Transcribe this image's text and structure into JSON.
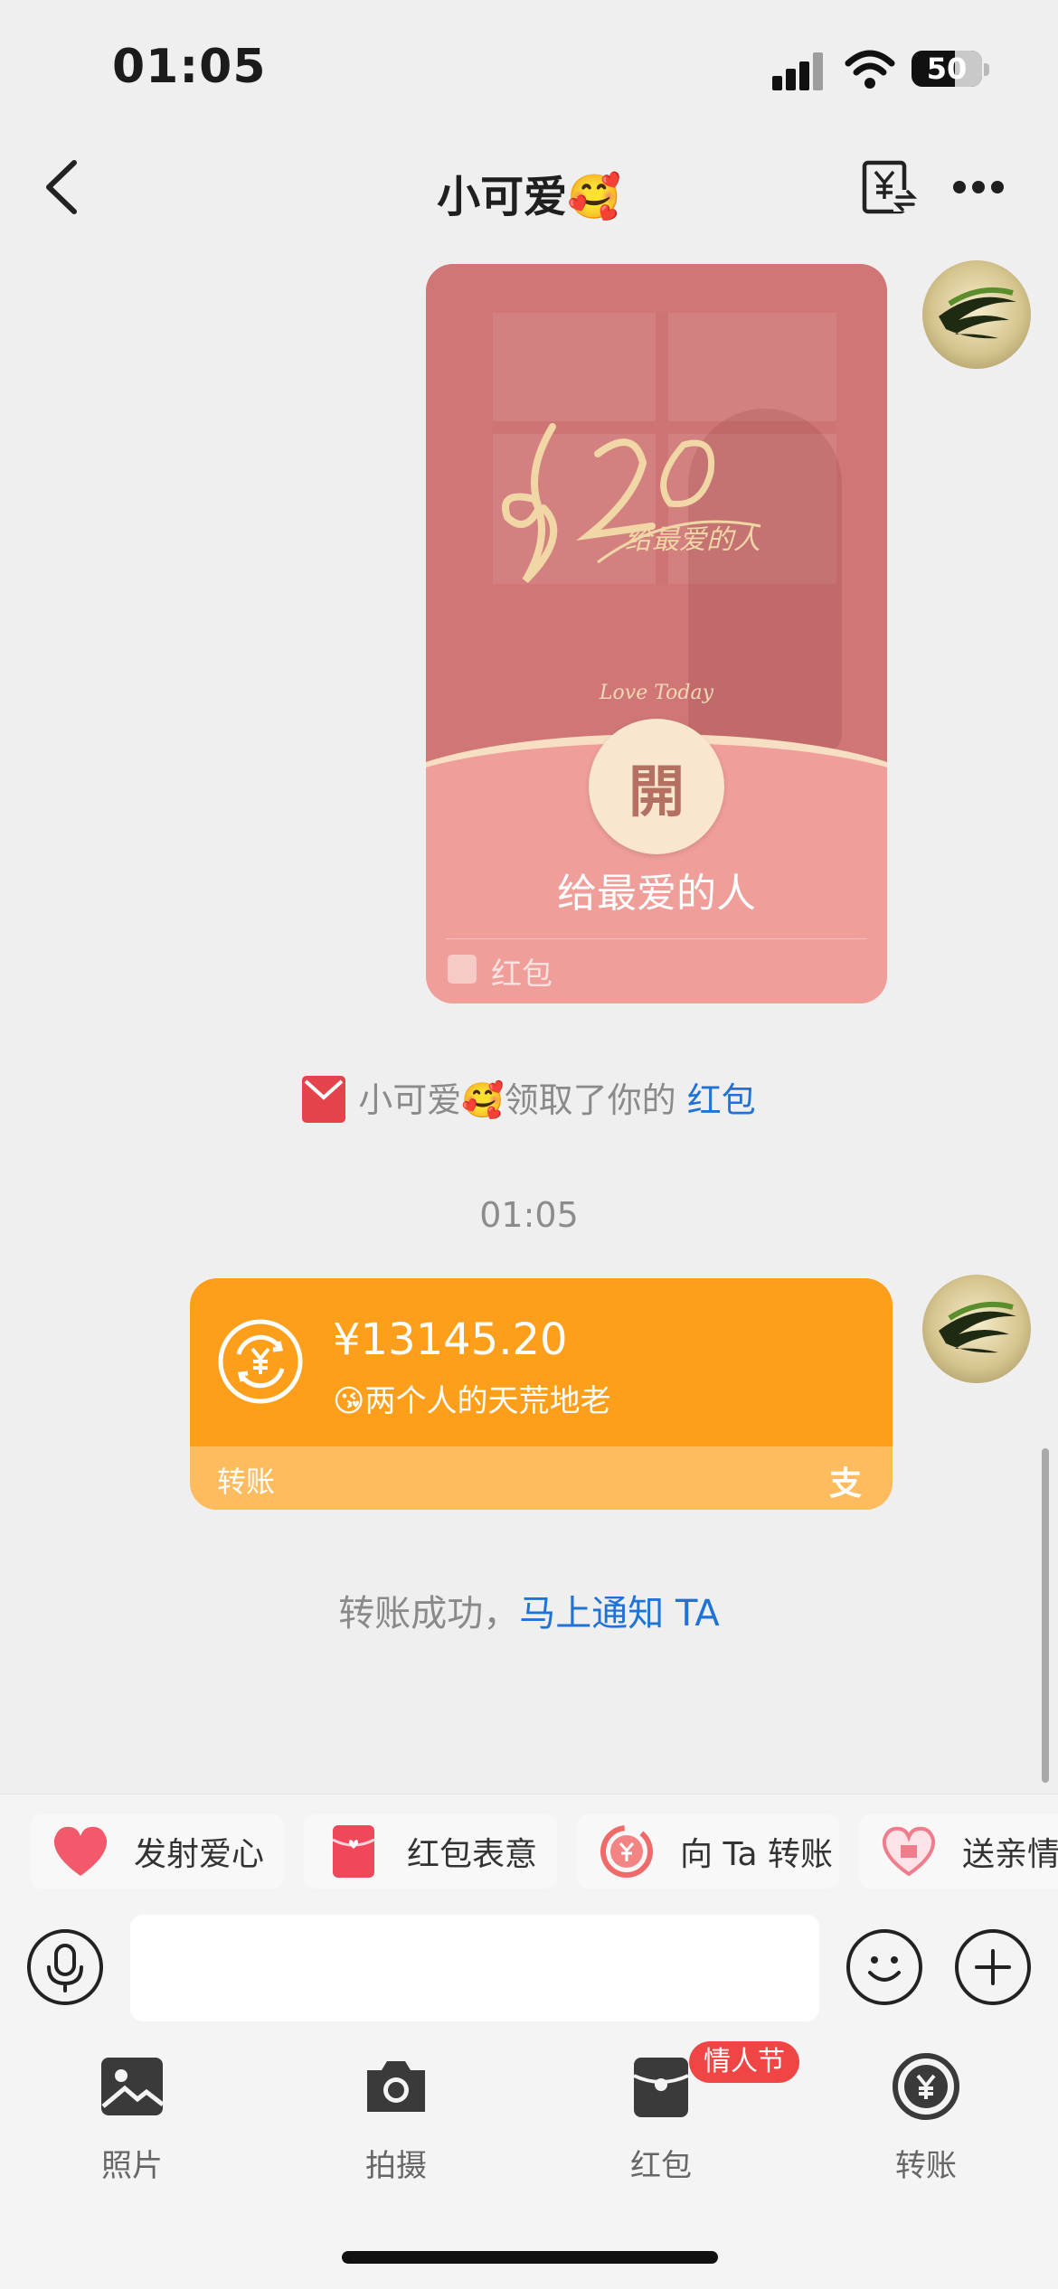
{
  "status_bar": {
    "time": "01:05",
    "battery": "50"
  },
  "nav": {
    "title": "小可爱🥰"
  },
  "red_packet": {
    "script_text": "520",
    "script_sub": "给最爱的人",
    "love_today": "Love Today",
    "open_label": "開",
    "title": "给最爱的人",
    "footer_label": "红包"
  },
  "notice": {
    "prefix": "小可爱🥰领取了你的 ",
    "link": "红包"
  },
  "timestamp": "01:05",
  "transfer": {
    "amount": "¥13145.20",
    "note": "😘两个人的天荒地老",
    "footer_label": "转账",
    "alipay_mark": "支"
  },
  "transfer_status": {
    "prefix": "转账成功，",
    "link": "马上通知 TA"
  },
  "quick_actions": [
    {
      "label": "发射爱心",
      "icon": "heart-icon"
    },
    {
      "label": "红包表意",
      "icon": "red-envelope-icon"
    },
    {
      "label": "向 Ta 转账",
      "icon": "transfer-icon"
    },
    {
      "label": "送亲情",
      "icon": "gift-heart-icon"
    }
  ],
  "input": {
    "value": "",
    "placeholder": ""
  },
  "toolbar": [
    {
      "label": "照片",
      "icon": "photo-icon"
    },
    {
      "label": "拍摄",
      "icon": "camera-icon"
    },
    {
      "label": "红包",
      "icon": "red-packet-icon"
    },
    {
      "label": "转账",
      "icon": "transfer-icon"
    }
  ],
  "toolbar_tag": "情人节",
  "colors": {
    "background": "#efefef",
    "packet": "#d07677",
    "transfer": "#fe9f1b",
    "link": "#1f73d6",
    "tag": "#f04545"
  }
}
